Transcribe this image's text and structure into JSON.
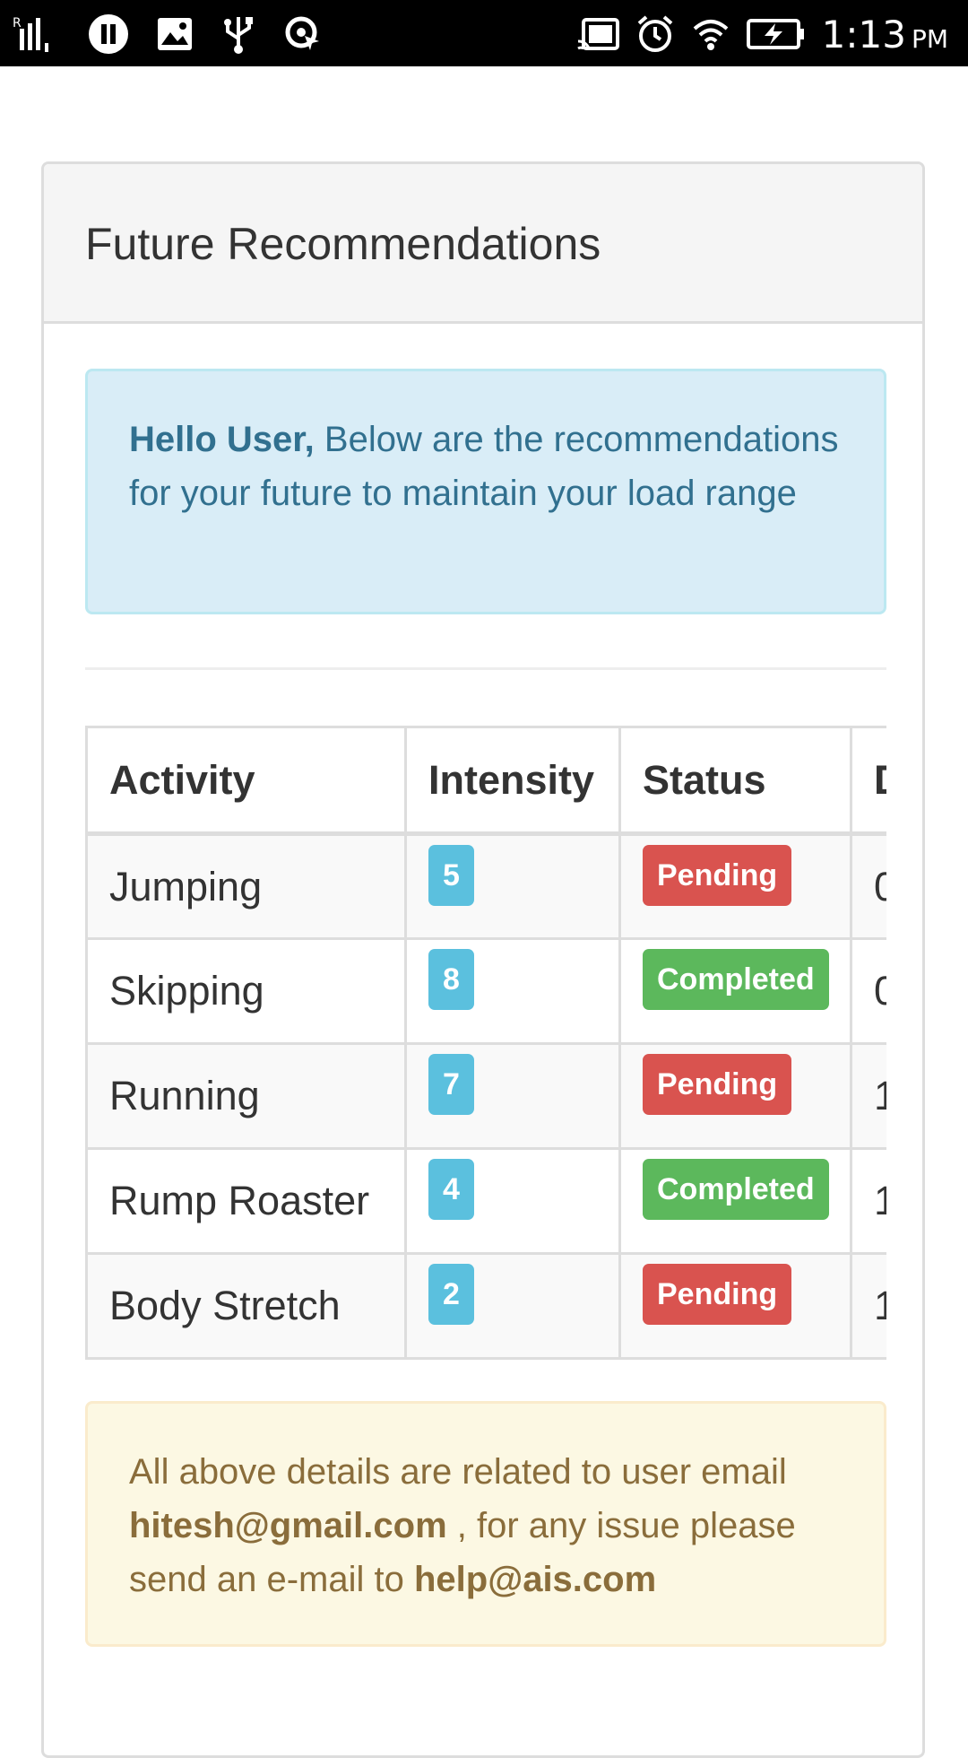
{
  "status_bar": {
    "carrier": "R",
    "time": "1:13",
    "ampm": "PM",
    "icons": [
      "signal-icon",
      "pause-icon",
      "image-icon",
      "usb-icon",
      "location-icon",
      "cast-icon",
      "alarm-icon",
      "wifi-icon",
      "battery-charging-icon"
    ]
  },
  "panel": {
    "title": "Future Recommendations"
  },
  "info_alert": {
    "greeting": "Hello User,",
    "message": "Below are the recommendations for your future to maintain your load range"
  },
  "table": {
    "headers": [
      "Activity",
      "Intensity",
      "Status",
      "D"
    ],
    "rows": [
      {
        "activity": "Jumping",
        "intensity": "5",
        "status": "Pending",
        "status_type": "danger",
        "date": "0"
      },
      {
        "activity": "Skipping",
        "intensity": "8",
        "status": "Completed",
        "status_type": "success",
        "date": "0"
      },
      {
        "activity": "Running",
        "intensity": "7",
        "status": "Pending",
        "status_type": "danger",
        "date": "1"
      },
      {
        "activity": "Rump Roaster",
        "intensity": "4",
        "status": "Completed",
        "status_type": "success",
        "date": "1"
      },
      {
        "activity": "Body Stretch",
        "intensity": "2",
        "status": "Pending",
        "status_type": "danger",
        "date": "1"
      }
    ]
  },
  "warning_alert": {
    "prefix": "All above details are related to user email",
    "user_email": "hitesh@gmail.com",
    "middle": ", for any issue please send an e-mail to",
    "help_email": "help@ais.com"
  },
  "colors": {
    "info_badge": "#5bc0de",
    "danger_badge": "#d9534f",
    "success_badge": "#5cb85c",
    "info_alert_bg": "#d9edf7",
    "warning_alert_bg": "#fcf8e3"
  }
}
